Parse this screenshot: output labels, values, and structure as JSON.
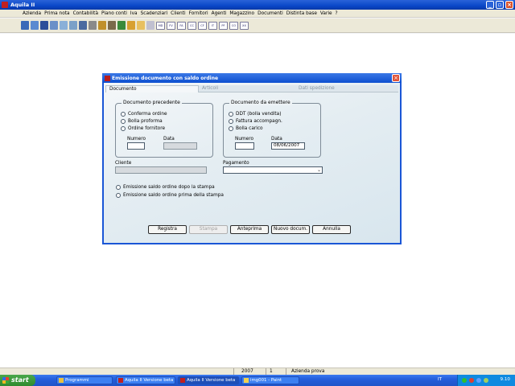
{
  "app": {
    "title": "Aquila II"
  },
  "menu": [
    "Azienda",
    "Prima nota",
    "Contabilità",
    "Piano conti",
    "Iva",
    "Scadenziari",
    "Clienti",
    "Fornitori",
    "Agenti",
    "Magazzino",
    "Documenti",
    "Distinta base",
    "Varie",
    "?"
  ],
  "toolbar": {
    "text_buttons": [
      "MD",
      "FV",
      "FA",
      "CC",
      "CF",
      "IT",
      "PF",
      "CO",
      "XX"
    ]
  },
  "dialog": {
    "title": "Emissione documento con saldo ordine",
    "tabs": [
      "Documento",
      "Articoli",
      "Dati spedizione"
    ],
    "prev_group": {
      "label": "Documento precedente",
      "options": [
        "Conferma ordine",
        "Bolla proforma",
        "Ordine fornitore"
      ],
      "numero_label": "Numero",
      "data_label": "Data"
    },
    "emit_group": {
      "label": "Documento da emettere",
      "options": [
        "DDT (bolla vendita)",
        "Fattura accompagn.",
        "Bolla carico"
      ],
      "numero_label": "Numero",
      "data_label": "Data",
      "data_value": "08/06/2007"
    },
    "cliente_label": "Cliente",
    "pagamento_label": "Pagamento",
    "emission_options": [
      "Emissione saldo ordine dopo la stampa",
      "Emissione saldo ordine prima della stampa"
    ],
    "buttons": {
      "registra": "Registra",
      "stampa": "Stampa",
      "anteprima": "Anteprima",
      "nuovo": "Nuovo docum.",
      "annulla": "Annulla"
    }
  },
  "statusbar": {
    "year": "2007",
    "number": "1",
    "company": "Azienda prova"
  },
  "taskbar": {
    "start": "start",
    "tasks": [
      "Programmi",
      "Aquila II  Versione beta",
      "Aquila II  Versione beta",
      "img001 - Paint"
    ],
    "lang": "IT",
    "time": "9.10"
  }
}
